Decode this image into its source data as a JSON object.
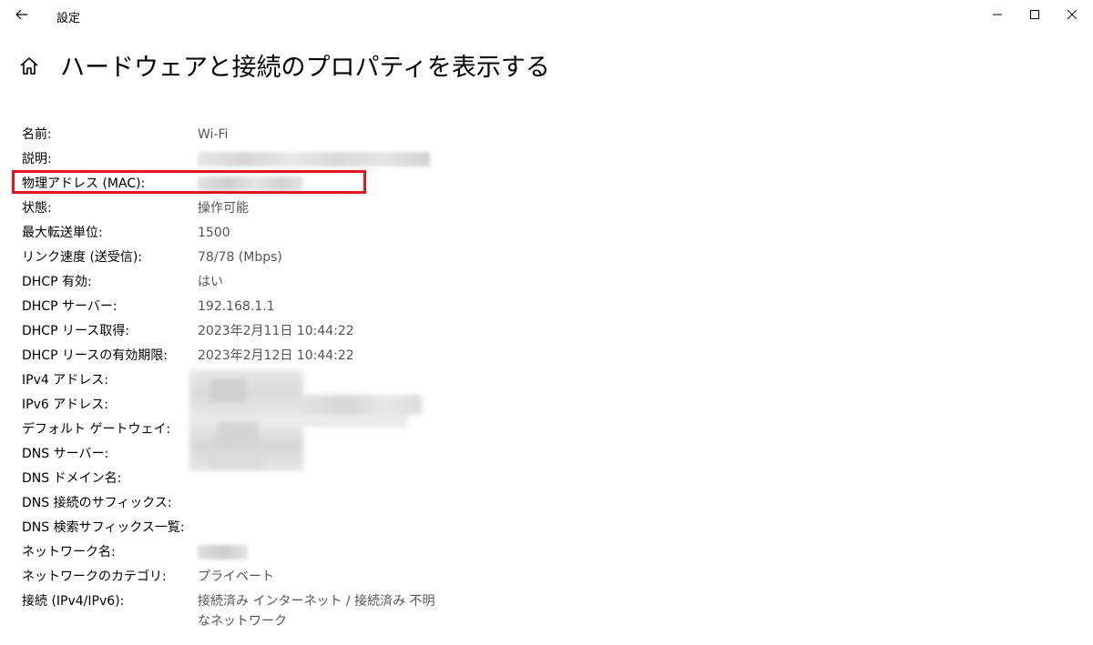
{
  "window": {
    "title": "設定"
  },
  "page": {
    "title": "ハードウェアと接続のプロパティを表示する"
  },
  "properties": [
    {
      "label": "名前:",
      "value": "Wi-Fi"
    },
    {
      "label": "説明:",
      "value": ""
    },
    {
      "label": "物理アドレス (MAC):",
      "value": ""
    },
    {
      "label": "状態:",
      "value": "操作可能"
    },
    {
      "label": "最大転送単位:",
      "value": "1500"
    },
    {
      "label": "リンク速度 (送受信):",
      "value": "78/78 (Mbps)"
    },
    {
      "label": "DHCP 有効:",
      "value": "はい"
    },
    {
      "label": "DHCP サーバー:",
      "value": "192.168.1.1"
    },
    {
      "label": "DHCP リース取得:",
      "value": "2023年2月11日 10:44:22"
    },
    {
      "label": "DHCP リースの有効期限:",
      "value": "2023年2月12日 10:44:22"
    },
    {
      "label": "IPv4 アドレス:",
      "value": ""
    },
    {
      "label": "IPv6 アドレス:",
      "value": ""
    },
    {
      "label": "デフォルト ゲートウェイ:",
      "value": ""
    },
    {
      "label": "DNS サーバー:",
      "value": ""
    },
    {
      "label": "DNS ドメイン名:",
      "value": ""
    },
    {
      "label": "DNS 接続のサフィックス:",
      "value": ""
    },
    {
      "label": "DNS 検索サフィックス一覧:",
      "value": ""
    },
    {
      "label": "ネットワーク名:",
      "value": ""
    },
    {
      "label": "ネットワークのカテゴリ:",
      "value": "プライベート"
    },
    {
      "label": "接続 (IPv4/IPv6):",
      "value": "接続済み インターネット / 接続済み 不明なネットワーク"
    }
  ],
  "colors": {
    "highlight": "#e3141f",
    "value_text": "#555555"
  }
}
